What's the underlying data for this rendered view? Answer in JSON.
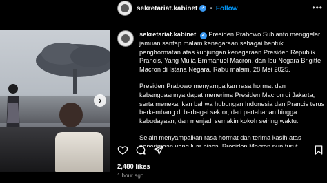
{
  "header": {
    "username": "sekretariat.kabinet",
    "separator": "•",
    "follow_label": "Follow",
    "more_label": "•••"
  },
  "caption": {
    "username": "sekretariat.kabinet",
    "paragraph1": "Presiden Prabowo Subianto menggelar jamuan santap malam kenegaraan sebagai bentuk penghormatan atas kunjungan kenegaraan Presiden Republik Prancis, Yang Mulia Emmanuel Macron, dan Ibu Negara Brigitte Macron di Istana Negara, Rabu malam, 28 Mei 2025.",
    "paragraph2": "Presiden Prabowo menyampaikan rasa hormat dan kebanggaannya dapat menerima Presiden Macron di Jakarta, serta menekankan bahwa hubungan Indonesia dan Prancis terus berkembang di berbagai sektor, dari pertahanan hingga kebudayaan, dan menjadi semakin kokoh seiring waktu.",
    "paragraph3": "Selain menyampaikan rasa hormat dan terima kasih atas penerimaan yang luar biasa, Presiden Macron pun turut mengutip"
  },
  "media": {
    "next_label": "›"
  },
  "stats": {
    "likes": "2,480 likes",
    "timestamp": "1 hour ago"
  },
  "colors": {
    "accent": "#0095f6",
    "verified": "#3897f0",
    "background": "#000000"
  },
  "icons": [
    "heart-icon",
    "comment-icon",
    "share-icon",
    "bookmark-icon",
    "verified-icon",
    "chevron-right-icon"
  ]
}
